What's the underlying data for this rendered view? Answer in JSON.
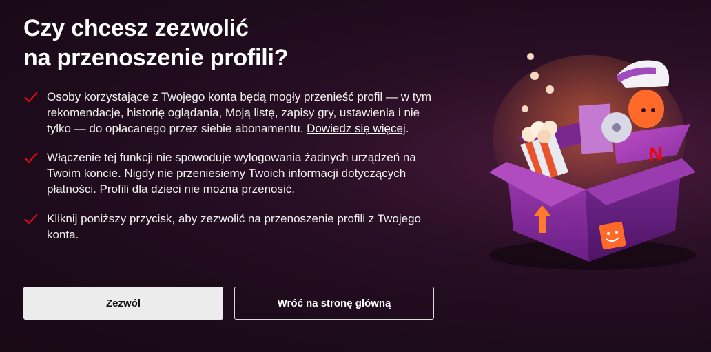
{
  "title": {
    "line1": "Czy chcesz zezwolić",
    "line2": "na przenoszenie profili?"
  },
  "items": [
    {
      "text": "Osoby korzystające z Twojego konta będą mogły przenieść profil — w tym rekomendacje, historię oglądania, Moją listę, zapisy gry, ustawienia i nie tylko — do opłacanego przez siebie abonamentu. ",
      "link": "Dowiedz się więcej",
      "after_link": "."
    },
    {
      "text": "Włączenie tej funkcji nie spowoduje wylogowania żadnych urządzeń na Twoim koncie. Nigdy nie przeniesiemy Twoich informacji dotyczących płatności. Profili dla dzieci nie można przenosić."
    },
    {
      "text": "Kliknij poniższy przycisk, aby zezwolić na przenoszenie profili z Twojego konta."
    }
  ],
  "buttons": {
    "allow": "Zezwól",
    "back": "Wróć na stronę główną"
  },
  "colors": {
    "check": "#e50914",
    "brand": "#e50914",
    "background": "#1c0b1b"
  },
  "illustration": {
    "box_logo": "N"
  }
}
